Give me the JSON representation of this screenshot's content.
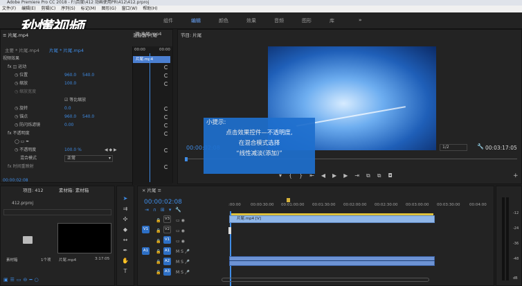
{
  "titlebar": {
    "text": "Adobe Premiere Pro CC 2018 - F:\\百度\\412 动画使用PR\\412\\412.prproj"
  },
  "menu": [
    "文件(F)",
    "编辑(E)",
    "剪辑(C)",
    "序列(S)",
    "标记(M)",
    "图形(G)",
    "窗口(W)",
    "帮助(H)"
  ],
  "workspaces": [
    "组件",
    "编辑",
    "颜色",
    "效果",
    "音频",
    "图形",
    "库"
  ],
  "logo": "秒懂视频",
  "effect_controls": {
    "title": "效果控件",
    "source_tab": "主要 * 片尾.mp4",
    "seq_tab": "片尾 * 片尾.mp4",
    "mini_time": "00:00",
    "mini_time2": "00:00",
    "clip_name": "片尾.mp4",
    "video_effects": "视频效果",
    "motion": "运动",
    "position": "位置",
    "position_x": "960.0",
    "position_y": "540.0",
    "scale": "缩放",
    "scale_val": "100.0",
    "scale_width": "缩放宽度",
    "uniform_scale": "等比缩放",
    "rotation": "旋转",
    "rotation_val": "0.0",
    "anchor": "锚点",
    "anchor_x": "960.0",
    "anchor_y": "540.0",
    "antiflicker": "防闪烁滤镜",
    "antiflicker_val": "0.00",
    "opacity": "不透明度",
    "opacity_prop": "不透明度",
    "opacity_val": "100.0 %",
    "blend_mode": "混合模式",
    "blend_val": "正常",
    "time_remap": "时间重映射",
    "timecode": "00:00:02:08"
  },
  "program": {
    "title": "节目: 片尾",
    "timecode_left": "00:00:02:08",
    "fit": "1/2",
    "timecode_right": "00:03:17:05"
  },
  "source_tab": "源:片尾.mp4",
  "mix_tab": "混音器:片尾",
  "tip": {
    "heading": "小提示:",
    "lines": [
      "点击效果控件—不透明度,",
      "在混合模式选择",
      "“线性减淡(添加)”"
    ]
  },
  "project": {
    "tab": "项目: 412",
    "tab2": "素材箱: 素材箱",
    "file": "412.prproj",
    "bin_label": "素材箱",
    "bin_count": "1个项",
    "clip_label": "片尾.mp4",
    "clip_dur": "3:17:05"
  },
  "timeline": {
    "title": "片尾",
    "timecode": "00:00:02:08",
    "ticks": [
      ":00:00",
      "00:00:30:00",
      "00:01:00:00",
      "00:01:30:00",
      "00:02:00:00",
      "00:02:30:00",
      "00:03:00:00",
      "00:03:30:00",
      "00:04:00"
    ],
    "tracks": [
      "V3",
      "V2",
      "V1",
      "A1",
      "A2",
      "A3"
    ],
    "src_v": "V1",
    "src_a": "A1",
    "clip_v2": "片尾.mp4 [V]"
  },
  "meter": {
    "labels": [
      "-12",
      "-24",
      "-36",
      "-48",
      "dB"
    ]
  }
}
